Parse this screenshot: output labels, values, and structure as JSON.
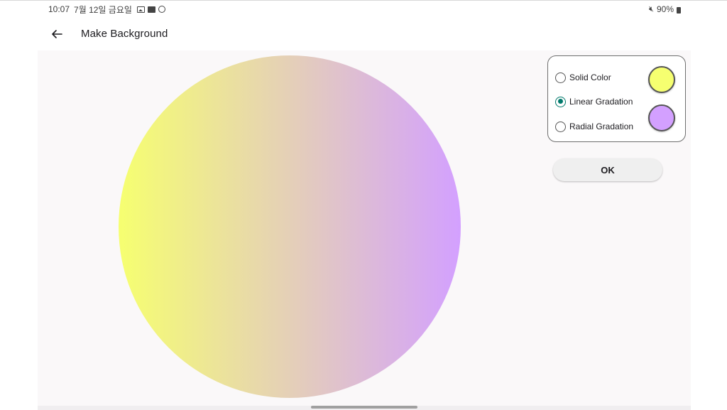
{
  "status_bar": {
    "time": "10:07",
    "date": "7월 12일 금요일",
    "battery": "90%",
    "icons": [
      "image-icon",
      "app-icon",
      "sync-icon",
      "mute-icon",
      "battery-icon"
    ]
  },
  "app_bar": {
    "back_icon": "arrow-left-icon",
    "title": "Make Background"
  },
  "preview": {
    "type": "linear-gradient",
    "start_color": "#f6ff70",
    "end_color": "#d3a0ff"
  },
  "options": {
    "items": [
      {
        "label": "Solid Color",
        "checked": false
      },
      {
        "label": "Linear Gradation",
        "checked": true
      },
      {
        "label": "Radial Gradation",
        "checked": false
      }
    ],
    "color1": "#f6ff70",
    "color2": "#d3a0ff"
  },
  "ok_button": {
    "label": "OK"
  }
}
